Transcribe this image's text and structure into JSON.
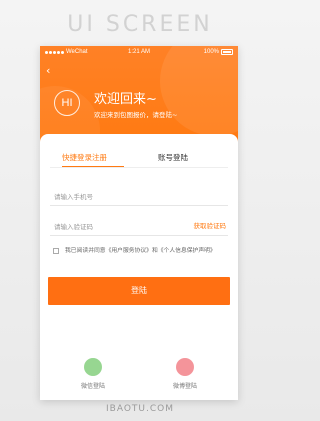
{
  "banner": {
    "title": "UI SCREEN",
    "watermark": "IBAOTU.COM"
  },
  "statusbar": {
    "carrier": "WeChat",
    "time": "1:21 AM",
    "battery": "100%"
  },
  "header": {
    "back_icon": "chevron-left-icon",
    "avatar_text": "HI",
    "welcome": "欢迎回来~",
    "subtitle": "欢迎来到包图报价，请登陆~"
  },
  "tabs": [
    {
      "label": "快捷登录注册",
      "active": true
    },
    {
      "label": "账号登陆",
      "active": false
    }
  ],
  "form": {
    "phone_placeholder": "请输入手机号",
    "code_placeholder": "请输入验证码",
    "get_code_label": "获取验证码",
    "agree_text": "我已阅读并同意《用户服务协议》和《个人信息保护声明》",
    "login_label": "登陆"
  },
  "social": [
    {
      "label": "微信登陆",
      "icon": "wechat-icon"
    },
    {
      "label": "微博登陆",
      "icon": "weibo-icon"
    }
  ],
  "colors": {
    "accent": "#ff7a12",
    "wechat": "#74c86c",
    "weibo": "#f07078"
  }
}
